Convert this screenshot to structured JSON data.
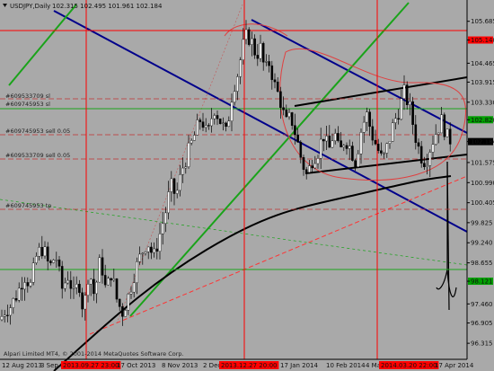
{
  "header": {
    "title": "USDJPY,Daily",
    "ohlc": "102.315 102.495 101.961 102.184"
  },
  "watermark": "Alpari Limited MT4, © 2001-2014 MetaQuotes Software Corp.",
  "price_axis": {
    "ticks": [
      "105.685",
      "105.140",
      "104.465",
      "103.915",
      "103.330",
      "102.820",
      "102.184",
      "101.575",
      "100.990",
      "100.405",
      "99.825",
      "99.240",
      "98.655",
      "98.121",
      "97.460",
      "96.905",
      "96.315"
    ],
    "highlighted": {
      "105.140": "#ff0000",
      "102.820": "#00a000",
      "102.184": "#000000",
      "98.121": "#00a000"
    }
  },
  "time_axis": {
    "labels": [
      "12 Aug 2013",
      "3 Sep 2",
      "2013.09.27 23:00",
      "17 Oct 2013",
      "8 Nov 2013",
      "2 Dec 2",
      "2013.12.27 20:00",
      "17 Jan 2014",
      "10 Feb 2014",
      "4 Mar 2",
      "2014.03.20 22:00",
      "17 Apr 2014"
    ],
    "highlighted": [
      "2013.09.27 23:00",
      "2013.12.27 20:00",
      "2014.03.20 22:00"
    ]
  },
  "level_labels": [
    "#609533709 sl",
    "#609745953 sl",
    "#609745953 sell 0.05",
    "#609533709 sell 0.05",
    "#609745953 tp"
  ],
  "colors": {
    "background": "#a9a9a9",
    "bull": "#ffffff",
    "bear": "#000000",
    "trend_blue": "#00008b",
    "trend_green": "#1aa31a",
    "red": "#ff0000",
    "black_line": "#000000"
  },
  "chart_data": {
    "type": "candlestick",
    "title": "USDJPY,Daily",
    "ylim": [
      95.9,
      106.2
    ],
    "close_series": [
      [
        0,
        97.0
      ],
      [
        6,
        97.3
      ],
      [
        12,
        97.4
      ],
      [
        20,
        97.8
      ],
      [
        27,
        98.3
      ],
      [
        34,
        98.0
      ],
      [
        41,
        98.9
      ],
      [
        48,
        99.1
      ],
      [
        55,
        98.5
      ],
      [
        62,
        98.9
      ],
      [
        69,
        97.9
      ],
      [
        76,
        98.3
      ],
      [
        82,
        97.7
      ],
      [
        88,
        98.1
      ],
      [
        93,
        97.2
      ],
      [
        99,
        98.5
      ],
      [
        105,
        97.7
      ],
      [
        112,
        98.8
      ],
      [
        118,
        97.8
      ],
      [
        124,
        98.4
      ],
      [
        130,
        97.6
      ],
      [
        136,
        97.2
      ],
      [
        143,
        97.7
      ],
      [
        150,
        98.4
      ],
      [
        157,
        98.9
      ],
      [
        164,
        99.3
      ],
      [
        171,
        98.8
      ],
      [
        178,
        99.5
      ],
      [
        184,
        100.1
      ],
      [
        190,
        100.9
      ],
      [
        196,
        100.6
      ],
      [
        203,
        101.4
      ],
      [
        210,
        101.9
      ],
      [
        217,
        102.4
      ],
      [
        224,
        102.9
      ],
      [
        231,
        102.3
      ],
      [
        238,
        103.2
      ],
      [
        245,
        102.8
      ],
      [
        252,
        102.4
      ],
      [
        259,
        103.7
      ],
      [
        265,
        104.2
      ],
      [
        270,
        104.9
      ],
      [
        275,
        105.3
      ],
      [
        280,
        105.1
      ],
      [
        285,
        104.7
      ],
      [
        290,
        104.9
      ],
      [
        295,
        104.2
      ],
      [
        300,
        104.5
      ],
      [
        306,
        103.8
      ],
      [
        312,
        103.4
      ],
      [
        318,
        102.7
      ],
      [
        324,
        102.9
      ],
      [
        330,
        102.3
      ],
      [
        336,
        101.6
      ],
      [
        342,
        101.2
      ],
      [
        348,
        101.7
      ],
      [
        354,
        101.9
      ],
      [
        360,
        102.4
      ],
      [
        366,
        101.9
      ],
      [
        372,
        102.5
      ],
      [
        378,
        101.8
      ],
      [
        384,
        102.3
      ],
      [
        390,
        102.0
      ],
      [
        396,
        101.6
      ],
      [
        402,
        102.5
      ],
      [
        408,
        103.0
      ],
      [
        414,
        102.4
      ],
      [
        420,
        102.0
      ],
      [
        426,
        101.6
      ],
      [
        432,
        102.1
      ],
      [
        438,
        102.7
      ],
      [
        444,
        103.1
      ],
      [
        450,
        103.6
      ],
      [
        456,
        103.2
      ],
      [
        462,
        102.4
      ],
      [
        468,
        101.8
      ],
      [
        474,
        101.6
      ],
      [
        480,
        102.1
      ],
      [
        486,
        102.5
      ],
      [
        492,
        102.8
      ],
      [
        498,
        102.3
      ],
      [
        504,
        102.2
      ]
    ],
    "trendlines": "descending blue channel, ascending green lines, black channel, red/dashed order levels"
  }
}
